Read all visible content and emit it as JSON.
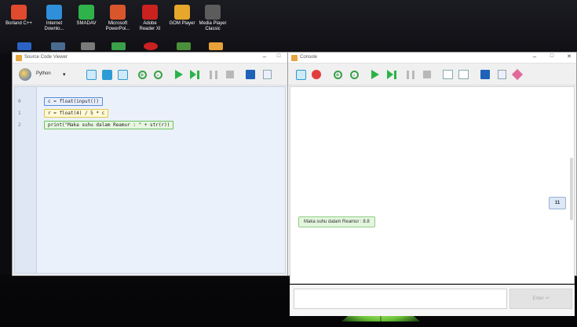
{
  "desktop": {
    "icons": [
      {
        "label": "Borland C++",
        "color": "#e04a2f"
      },
      {
        "label": "Internet\nDownlo...",
        "color": "#2f8fd8"
      },
      {
        "label": "SMADAV",
        "color": "#2fb24a"
      },
      {
        "label": "Microsoft\nPowerPoi...",
        "color": "#d9562d"
      },
      {
        "label": "Adobe\nReader XI",
        "color": "#c9221f"
      },
      {
        "label": "GOM Player",
        "color": "#e6a72b"
      },
      {
        "label": "Media Player\nClassic",
        "color": "#5c5c5c"
      }
    ]
  },
  "source_window": {
    "title": "Source Code Viewer",
    "language": "Python",
    "window_controls": {
      "minimize": "–",
      "maximize": "□"
    },
    "lines": [
      {
        "number": "0",
        "code": "c = float(input())"
      },
      {
        "number": "1",
        "code": "r = float(4) / 5 * c"
      },
      {
        "number": "2",
        "code": "print(\"Maka suhu dalam Reamur : \" + str(r))"
      }
    ]
  },
  "console_window": {
    "title": "Console",
    "window_controls": {
      "minimize": "–",
      "maximize": "□",
      "close": "✕"
    },
    "input_echo": "11",
    "output": "Maka suhu dalam Reamur : 8.8",
    "enter_label": "Enter ⏎"
  },
  "colors": {
    "output_bg": "#e4f6df",
    "line0_border": "#5b8bd6",
    "line1_border": "#e2c74a",
    "line2_border": "#6fc262",
    "run_green": "#2bb34a"
  }
}
